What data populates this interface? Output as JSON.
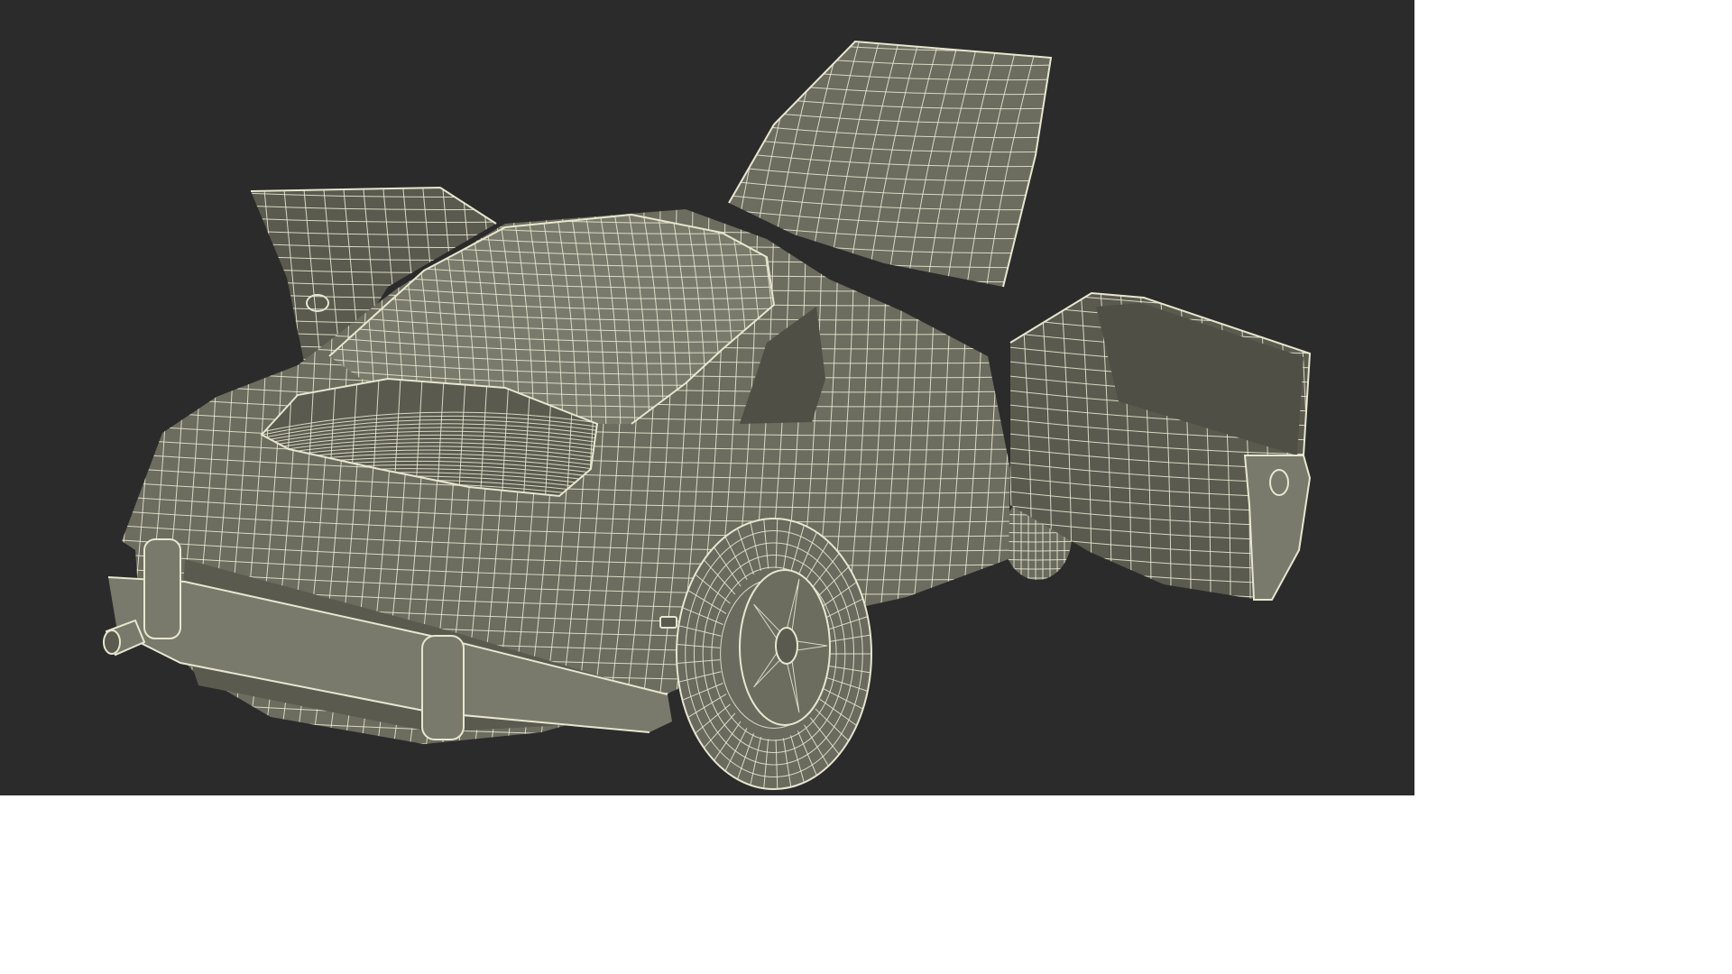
{
  "scene": {
    "subject": "wireframe-render-classic-coupe-rear-three-quarter",
    "doors_open": true,
    "hood_open": true,
    "colors": {
      "background": "#2b2b2b",
      "surface": "#6c6c5f",
      "surface_dark": "#5a5a4f",
      "surface_light": "#7a7a6c",
      "interior": "#4f4f45",
      "wire": "#e8e6cf",
      "tire": "#6a6a5e"
    }
  }
}
